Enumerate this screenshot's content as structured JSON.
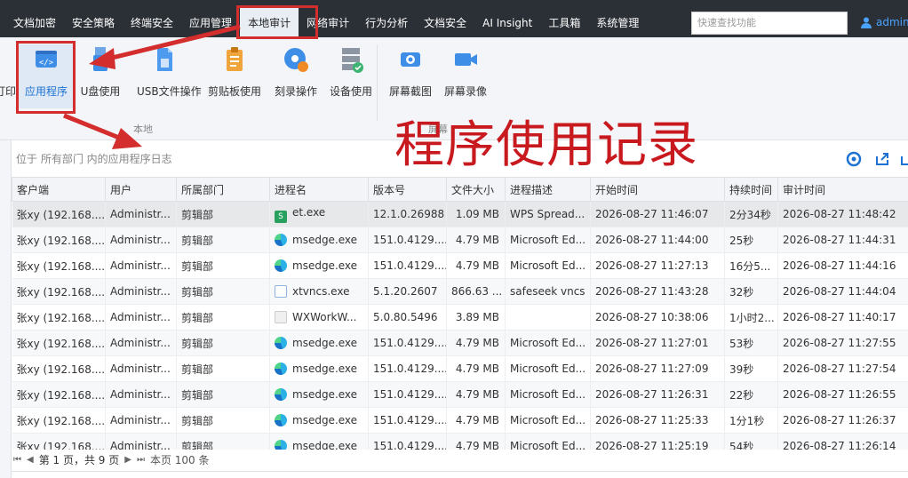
{
  "menu": [
    "文档加密",
    "安全策略",
    "终端安全",
    "应用管理",
    "本地审计",
    "网络审计",
    "行为分析",
    "文档安全",
    "AI Insight",
    "工具箱",
    "系统管理"
  ],
  "menu_active": "本地审计",
  "search_placeholder": "快速查找功能",
  "user_name": "admin",
  "ribbon": {
    "partial_left": "打印",
    "buttons": [
      "应用程序",
      "U盘使用",
      "USB文件操作",
      "剪贴板使用",
      "刻录操作",
      "设备使用",
      "屏幕截图",
      "屏幕录像"
    ],
    "selected": "应用程序",
    "group_local": "本地",
    "group_screen": "屏幕"
  },
  "annotation": "程序使用记录",
  "breadcrumb": "位于 所有部门 内的应用程序日志",
  "table": {
    "columns": [
      "客户端",
      "用户",
      "所属部门",
      "进程名",
      "版本号",
      "文件大小",
      "进程描述",
      "开始时间",
      "持续时间",
      "审计时间"
    ],
    "rows": [
      {
        "client": "张xy (192.168....",
        "user": "Administr...",
        "dept": "剪辑部",
        "proc": "et.exe",
        "icon": "et",
        "ver": "12.1.0.26988",
        "size": "1.09 MB",
        "desc": "WPS Spread...",
        "start": "2026-08-27 11:46:07",
        "dur": "2分34秒",
        "audit": "2026-08-27 11:48:42"
      },
      {
        "client": "张xy (192.168....",
        "user": "Administr...",
        "dept": "剪辑部",
        "proc": "msedge.exe",
        "icon": "edge",
        "ver": "151.0.4129....",
        "size": "4.79 MB",
        "desc": "Microsoft Ed...",
        "start": "2026-08-27 11:44:00",
        "dur": "25秒",
        "audit": "2026-08-27 11:44:31"
      },
      {
        "client": "张xy (192.168....",
        "user": "Administr...",
        "dept": "剪辑部",
        "proc": "msedge.exe",
        "icon": "edge",
        "ver": "151.0.4129....",
        "size": "4.79 MB",
        "desc": "Microsoft Ed...",
        "start": "2026-08-27 11:27:13",
        "dur": "16分5...",
        "audit": "2026-08-27 11:44:16"
      },
      {
        "client": "张xy (192.168....",
        "user": "Administr...",
        "dept": "剪辑部",
        "proc": "xtvncs.exe",
        "icon": "vnc",
        "ver": "5.1.20.2607",
        "size": "866.63 ...",
        "desc": "safeseek vncs",
        "start": "2026-08-27 11:43:28",
        "dur": "32秒",
        "audit": "2026-08-27 11:44:04"
      },
      {
        "client": "张xy (192.168....",
        "user": "Administr...",
        "dept": "剪辑部",
        "proc": "WXWorkW...",
        "icon": "wx",
        "ver": "5.0.80.5496",
        "size": "3.89 MB",
        "desc": "",
        "start": "2026-08-27 10:38:06",
        "dur": "1小时2...",
        "audit": "2026-08-27 11:40:17"
      },
      {
        "client": "张xy (192.168....",
        "user": "Administr...",
        "dept": "剪辑部",
        "proc": "msedge.exe",
        "icon": "edge",
        "ver": "151.0.4129....",
        "size": "4.79 MB",
        "desc": "Microsoft Ed...",
        "start": "2026-08-27 11:27:01",
        "dur": "53秒",
        "audit": "2026-08-27 11:27:55"
      },
      {
        "client": "张xy (192.168....",
        "user": "Administr...",
        "dept": "剪辑部",
        "proc": "msedge.exe",
        "icon": "edge",
        "ver": "151.0.4129....",
        "size": "4.79 MB",
        "desc": "Microsoft Ed...",
        "start": "2026-08-27 11:27:09",
        "dur": "39秒",
        "audit": "2026-08-27 11:27:54"
      },
      {
        "client": "张xy (192.168....",
        "user": "Administr...",
        "dept": "剪辑部",
        "proc": "msedge.exe",
        "icon": "edge",
        "ver": "151.0.4129....",
        "size": "4.79 MB",
        "desc": "Microsoft Ed...",
        "start": "2026-08-27 11:26:31",
        "dur": "22秒",
        "audit": "2026-08-27 11:26:55"
      },
      {
        "client": "张xy (192.168....",
        "user": "Administr...",
        "dept": "剪辑部",
        "proc": "msedge.exe",
        "icon": "edge",
        "ver": "151.0.4129....",
        "size": "4.79 MB",
        "desc": "Microsoft Ed...",
        "start": "2026-08-27 11:25:33",
        "dur": "1分1秒",
        "audit": "2026-08-27 11:26:37"
      },
      {
        "client": "张xy (192.168....",
        "user": "Administr...",
        "dept": "剪辑部",
        "proc": "msedge.exe",
        "icon": "edge",
        "ver": "151.0.4129....",
        "size": "4.79 MB",
        "desc": "Microsoft Ed...",
        "start": "2026-08-27 11:25:19",
        "dur": "54秒",
        "audit": "2026-08-27 11:26:14"
      }
    ]
  },
  "pager": {
    "page_label": "第 1 页，共 9 页",
    "page_count": "本页 100 条"
  }
}
